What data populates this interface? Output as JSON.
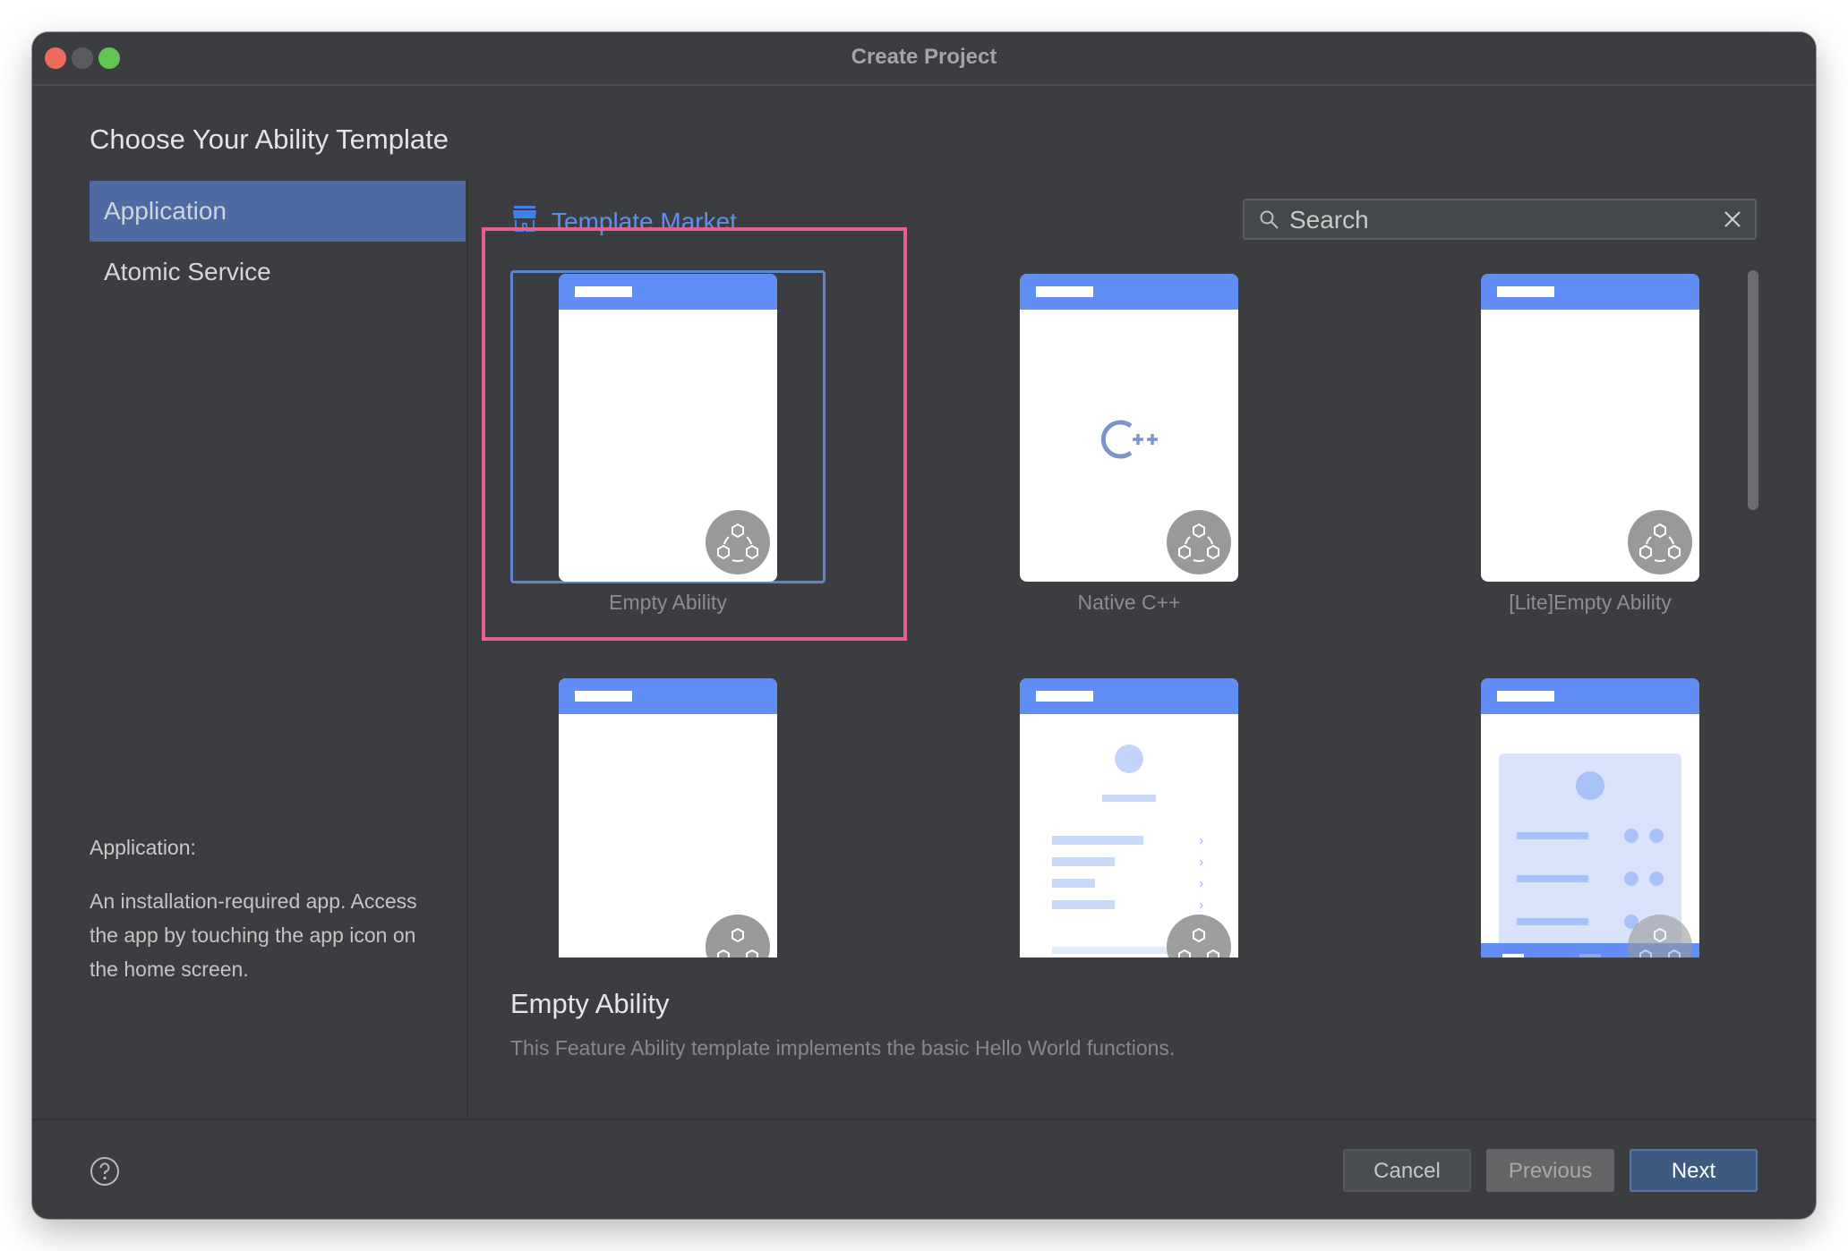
{
  "window": {
    "title": "Create Project"
  },
  "heading": "Choose Your Ability Template",
  "sidebar": {
    "items": [
      {
        "label": "Application",
        "selected": true
      },
      {
        "label": "Atomic Service",
        "selected": false
      }
    ],
    "description": {
      "label": "Application:",
      "text": "An installation-required app. Access the app by touching the app icon on the home screen."
    }
  },
  "market": {
    "label": "Template Market",
    "icon": "store-icon"
  },
  "search": {
    "placeholder": "Search",
    "value": "",
    "icon": "search-icon",
    "clear_icon": "close-icon"
  },
  "templates": [
    {
      "label": "Empty Ability",
      "preview": "empty",
      "selected": true
    },
    {
      "label": "Native C++",
      "preview": "cpp",
      "selected": false
    },
    {
      "label": "[Lite]Empty Ability",
      "preview": "empty",
      "selected": false
    },
    {
      "label": "",
      "preview": "empty",
      "selected": false
    },
    {
      "label": "",
      "preview": "list",
      "selected": false
    },
    {
      "label": "",
      "preview": "card-list",
      "selected": false
    }
  ],
  "details": {
    "title": "Empty Ability",
    "description": "This Feature Ability template implements the basic Hello World functions."
  },
  "footer": {
    "help_icon": "help-icon",
    "cancel_label": "Cancel",
    "previous_label": "Previous",
    "next_label": "Next"
  },
  "colors": {
    "accent": "#608ef4",
    "selection_border": "#5b86c8",
    "highlight": "#e5618c",
    "primary_button": "#3e5a80"
  }
}
